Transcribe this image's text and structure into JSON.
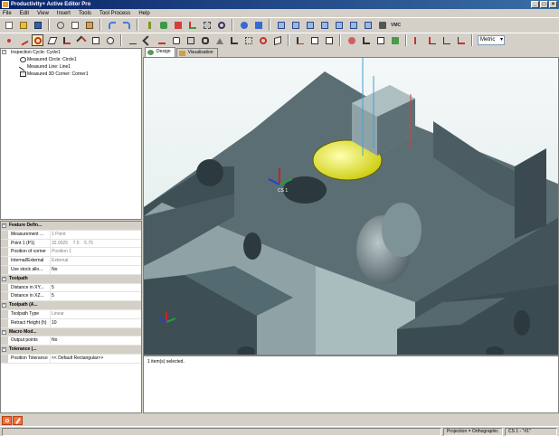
{
  "window": {
    "title": "Productivity+ Active Editor Pro"
  },
  "menu": [
    "File",
    "Edit",
    "View",
    "Insert",
    "Tools",
    "Tool Process",
    "Help"
  ],
  "toolbar": {
    "vmc_label": "VMC",
    "metric_value": "Metric"
  },
  "tree": {
    "items": [
      {
        "label": "Inspection Cycle: Cycle1"
      },
      {
        "label": "Measured Circle: Circle1"
      },
      {
        "label": "Measured Line: Line1"
      },
      {
        "label": "Measured 3D Corner: Corner1"
      }
    ]
  },
  "properties": {
    "feature_def": {
      "title": "Feature Defin...",
      "rows": [
        {
          "label": "Measurement ...",
          "value": "1 Point"
        },
        {
          "label": "Point 1 (P1)",
          "v1": "32.0025",
          "v2": "7.5",
          "v3": "5.75"
        },
        {
          "label": "Position of corner",
          "value": "Position 1"
        },
        {
          "label": "Internal/External",
          "value": "External"
        },
        {
          "label": "Use stock allo...",
          "value": "No"
        }
      ]
    },
    "toolpath": {
      "title": "Toolpath",
      "rows": [
        {
          "label": "Distance in XY...",
          "value": "5"
        },
        {
          "label": "Distance in XZ...",
          "value": "5"
        }
      ]
    },
    "toolpath_a": {
      "title": "Toolpath (A...",
      "rows": [
        {
          "label": "Toolpath Type",
          "value": "Linear"
        },
        {
          "label": "Retract Height (h)",
          "value": "10"
        }
      ]
    },
    "macro": {
      "title": "Macro Mod...",
      "rows": [
        {
          "label": "Output points",
          "value": "No"
        }
      ]
    },
    "tolerance": {
      "title": "Tolerance (...",
      "rows": [
        {
          "label": "Position Tolerance",
          "value": "<< Default Rectangular>>"
        }
      ]
    }
  },
  "tabs": [
    {
      "label": "Design"
    },
    {
      "label": "Visualisation"
    }
  ],
  "viewport": {
    "csys_label": "CS 1"
  },
  "output": {
    "message": "1 item(s) selected."
  },
  "status": {
    "projection": "Projection = Orthographic",
    "cs": "CS 1 - \"#1\""
  },
  "colors": {
    "part_dark": "#3d4f55",
    "part_mid": "#5f7479",
    "part_light": "#9fb2b5",
    "highlight": "#f0f000"
  }
}
